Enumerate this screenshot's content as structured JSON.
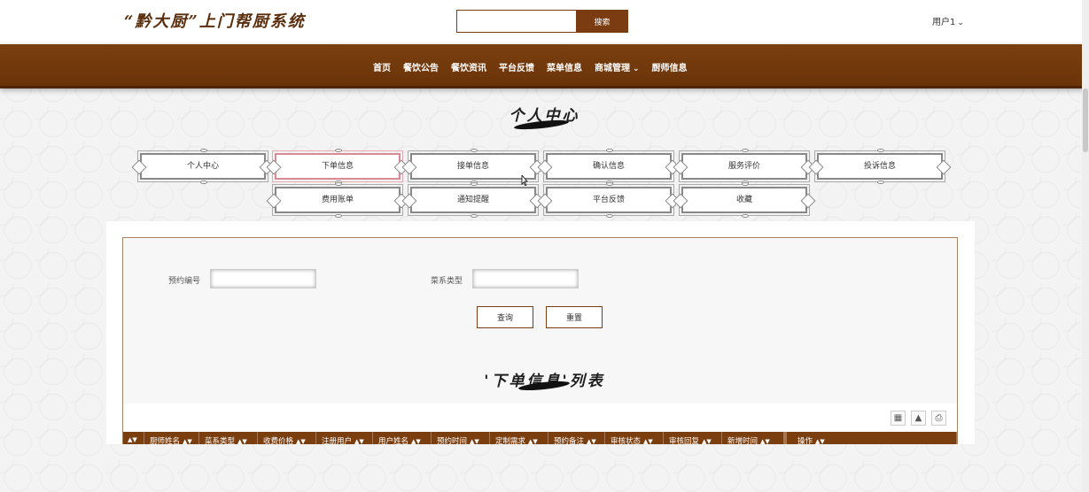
{
  "header": {
    "logo_text": "“黔大厨”上门帮厨系统",
    "search_value": "",
    "search_button": "搜索",
    "user_label": "用户1"
  },
  "nav": {
    "items": [
      "首页",
      "餐饮公告",
      "餐饮资讯",
      "平台反馈",
      "菜单信息",
      "商城管理",
      "厨师信息"
    ]
  },
  "personal_center": {
    "title": "个人中心",
    "tabs": [
      "个人中心",
      "下单信息",
      "接单信息",
      "确认信息",
      "服务评价",
      "投诉信息",
      "费用账单",
      "通知提醒",
      "平台反馈",
      "收藏"
    ],
    "active_tab": "下单信息"
  },
  "search_form": {
    "field1_label": "预约编号",
    "field1_value": "",
    "field2_label": "菜系类型",
    "field2_value": "",
    "query_button": "查询",
    "reset_button": "重置"
  },
  "list": {
    "title": "'下单信息'列表",
    "columns": [
      "",
      "厨师姓名",
      "菜系类型",
      "收费价格",
      "注册用户",
      "用户姓名",
      "预约时间",
      "定制需求",
      "预约备注",
      "审核状态",
      "审核回复",
      "新增时间",
      "操作"
    ]
  },
  "colors": {
    "brand": "#7b3f0f",
    "active_tab_border": "#d88b96"
  }
}
